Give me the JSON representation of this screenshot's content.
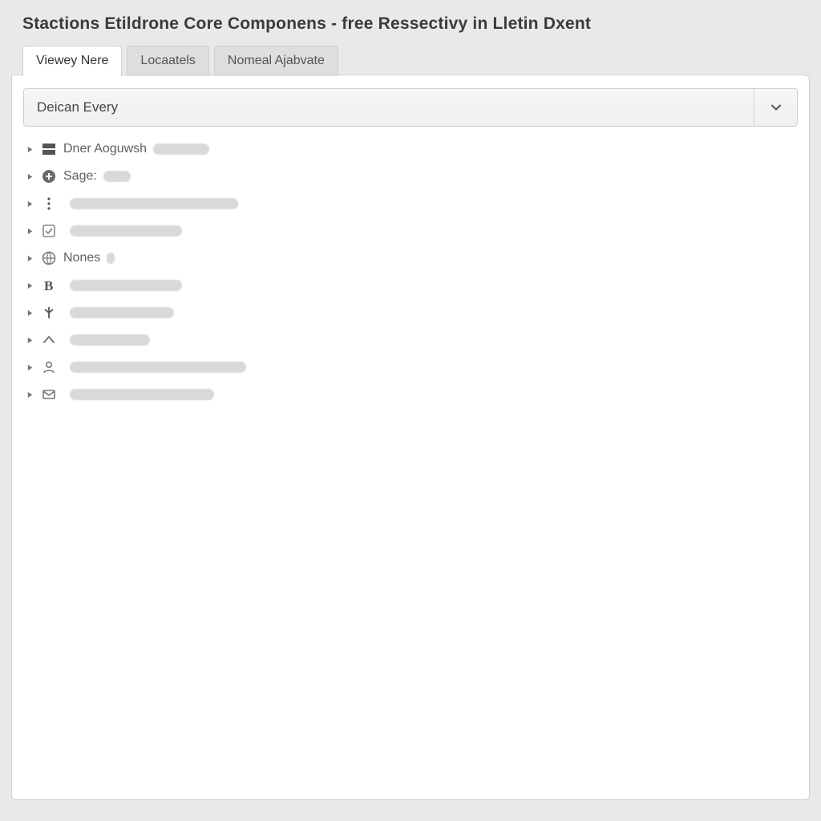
{
  "header": {
    "title": "Stactions Etildrone Core Componens - free Ressectivy in Lletin Dxent"
  },
  "tabs": [
    {
      "id": "viewey",
      "label": "Viewey Nere",
      "active": true
    },
    {
      "id": "locatas",
      "label": "Locaatels",
      "active": false
    },
    {
      "id": "nomenal",
      "label": "Nomeal Ajabvate",
      "active": false
    }
  ],
  "combo": {
    "label": "Deican Every",
    "icon": "chevron-down-icon"
  },
  "tree": [
    {
      "icon": "layout-icon",
      "label": "Dner Aoguwsh",
      "blur_w": 70
    },
    {
      "icon": "circle-plus-icon",
      "label": "Sage:",
      "blur_w": 34
    },
    {
      "icon": "dots-icon",
      "label": "",
      "blur_w": 210
    },
    {
      "icon": "checkbox-icon",
      "label": "",
      "blur_w": 140
    },
    {
      "icon": "globe-icon",
      "label": "Nones",
      "blur_w": 10
    },
    {
      "icon": "bold-b-icon",
      "label": "",
      "blur_w": 140
    },
    {
      "icon": "branch-icon",
      "label": "",
      "blur_w": 130
    },
    {
      "icon": "caret-up-icon",
      "label": "",
      "blur_w": 100
    },
    {
      "icon": "user-icon",
      "label": "",
      "blur_w": 220
    },
    {
      "icon": "mail-icon",
      "label": "",
      "blur_w": 180
    }
  ],
  "colors": {
    "page_bg": "#e9e9e9",
    "panel_bg": "#ffffff",
    "border": "#d0d0d0",
    "text": "#333333",
    "muted": "#606060"
  }
}
